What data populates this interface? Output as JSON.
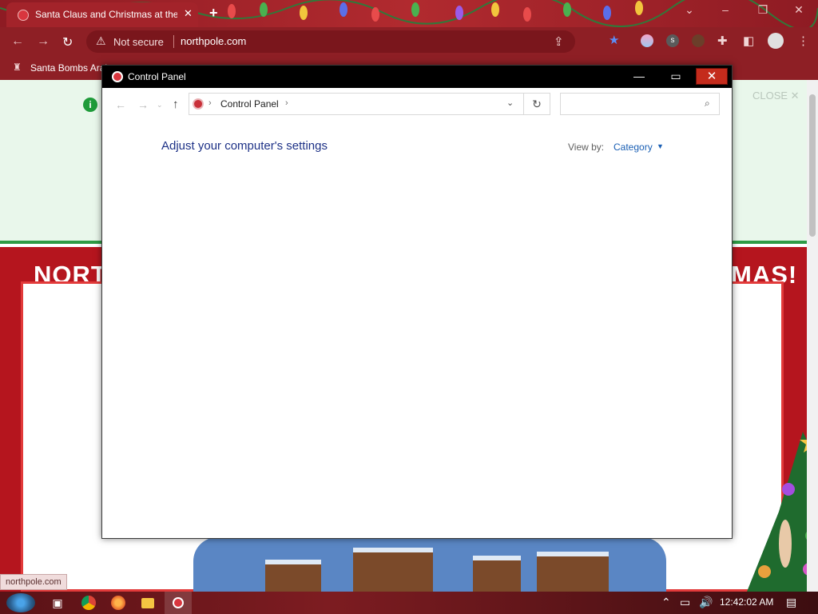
{
  "browser": {
    "tab_title": "Santa Claus and Christmas at the North Pole",
    "not_secure_label": "Not secure",
    "url": "northpole.com",
    "bookmark_label": "Santa Bombs Arabs",
    "profile_initial": "s"
  },
  "page": {
    "banner_close": "CLOSE ✕",
    "title_left": "NORT",
    "title_right": "MAS!",
    "status_link": "northpole.com"
  },
  "control_panel": {
    "window_title": "Control Panel",
    "breadcrumb": [
      "Control Panel"
    ],
    "search_placeholder": "",
    "heading": "Adjust your computer's settings",
    "view_by_label": "View by:",
    "view_by_value": "Category"
  },
  "taskbar": {
    "time": "12:42:02 AM"
  },
  "colors": {
    "chrome_frame": "#8e1f25",
    "cp_heading": "#1e3287",
    "cp_link": "#1a5fb4",
    "close_button": "#c42b1c"
  },
  "icons": {
    "back": "arrow-left-icon",
    "forward": "arrow-right-icon",
    "reload": "reload-icon",
    "warning": "warning-icon",
    "share": "share-icon",
    "bookmark_star": "star-icon",
    "extensions": "puzzle-icon",
    "sidebar": "sidebar-icon",
    "profile": "profile-icon",
    "menu": "kebab-menu-icon"
  }
}
